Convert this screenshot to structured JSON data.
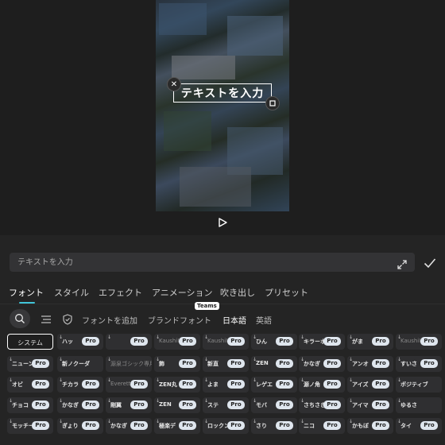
{
  "preview": {
    "overlay_text": "テキストを入力",
    "close_icon": "close-icon",
    "resize_icon": "resize-icon",
    "play_icon": "play-icon"
  },
  "editor": {
    "input_placeholder": "テキストを入力",
    "input_value": "",
    "expand_icon": "expand-icon",
    "confirm_icon": "checkmark-icon"
  },
  "tabs": [
    {
      "label": "フォント",
      "active": true
    },
    {
      "label": "スタイル"
    },
    {
      "label": "エフェクト"
    },
    {
      "label": "アニメーション"
    },
    {
      "label": "吹き出し"
    },
    {
      "label": "プリセット"
    }
  ],
  "filters": {
    "search_icon": "search-icon",
    "list_icon": "list-icon",
    "favorite_icon": "shield-check-icon",
    "items": [
      {
        "label": "フォントを追加"
      },
      {
        "label": "ブランドフォント",
        "badge": "Teams"
      },
      {
        "label": "日本語",
        "active": true
      },
      {
        "label": "英語"
      }
    ]
  },
  "fonts": {
    "pro_label": "Pro",
    "rows": [
      [
        "システム",
        "ハッ",
        "",
        "KaushiI",
        "KaushiI",
        "ひん",
        "キラーホ",
        "がま",
        "KaushiI"
      ],
      [
        "ニューン",
        "新ノクーダ",
        "源泉ゴシック専用",
        "飾",
        "新直",
        "ZEN",
        "かなぎ",
        "アンオ",
        "すいさ"
      ],
      [
        "オビ",
        "チカラ",
        "Everett",
        "ZEN丸",
        "よま",
        "レゲエ",
        "源ノ角",
        "アイズ",
        "ポジティブ"
      ],
      [
        "チョコ",
        "かなぎ",
        "剛翼",
        "ZEN",
        "ステ",
        "モバ",
        "さちさき",
        "アイマ",
        "ゆるさ"
      ],
      [
        "モッチー",
        "ぎょり",
        "かなぎ",
        "極楽デ",
        "ロックン",
        "さり",
        "ニコ",
        "かもぼ",
        "タイ"
      ]
    ]
  },
  "colors": {
    "accent": "#40c4d8",
    "panel_bg": "#242424",
    "pro_badge": "#dfe6ee"
  }
}
